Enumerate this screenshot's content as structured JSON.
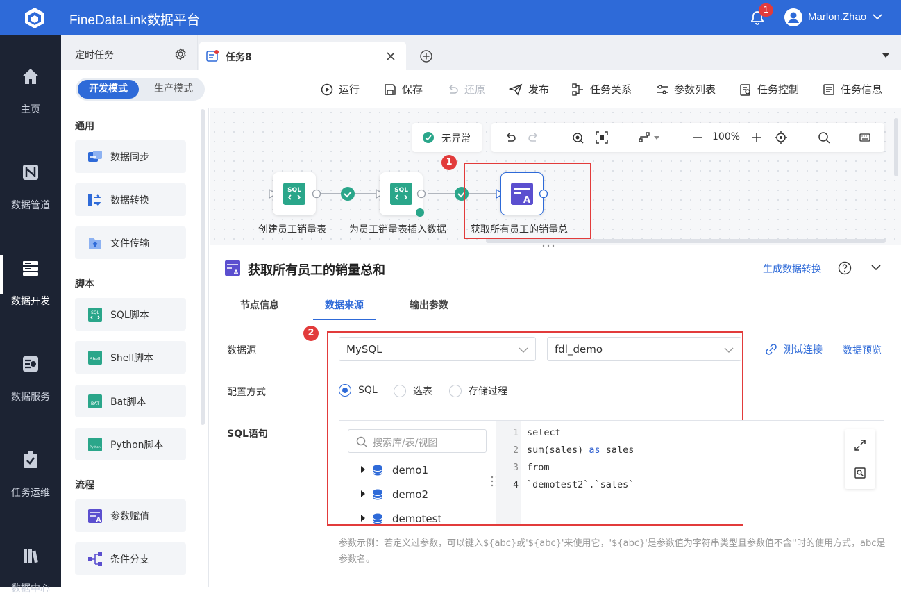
{
  "app": {
    "title": "FineDataLink数据平台",
    "notifications": "1",
    "user": "Marlon.Zhao"
  },
  "leftnav": [
    {
      "label": "主页",
      "icon": "home-icon"
    },
    {
      "label": "数据管道",
      "icon": "pipeline-icon"
    },
    {
      "label": "数据开发",
      "icon": "data-dev-icon",
      "active": true
    },
    {
      "label": "数据服务",
      "icon": "data-service-icon"
    },
    {
      "label": "任务运维",
      "icon": "task-ops-icon"
    },
    {
      "label": "数据中心",
      "icon": "data-center-icon"
    }
  ],
  "tabs": {
    "fixed": "定时任务",
    "active": "任务8"
  },
  "toolbar": {
    "mode_dev": "开发模式",
    "mode_prod": "生产模式",
    "run": "运行",
    "save": "保存",
    "restore": "还原",
    "publish": "发布",
    "relations": "任务关系",
    "params": "参数列表",
    "control": "任务控制",
    "info": "任务信息"
  },
  "palette": {
    "groups": [
      {
        "title": "通用",
        "items": [
          "数据同步",
          "数据转换",
          "文件传输"
        ]
      },
      {
        "title": "脚本",
        "items": [
          "SQL脚本",
          "Shell脚本",
          "Bat脚本",
          "Python脚本"
        ]
      },
      {
        "title": "流程",
        "items": [
          "参数赋值",
          "条件分支"
        ]
      }
    ]
  },
  "canvas": {
    "status": "无异常",
    "zoom": "100%",
    "nodes": [
      "创建员工销量表",
      "为员工销量表插入数据",
      "获取所有员工的销量总"
    ],
    "markers": [
      "1",
      "2"
    ]
  },
  "panel": {
    "title": "获取所有员工的销量总和",
    "gen_link": "生成数据转换",
    "tabs": [
      "节点信息",
      "数据来源",
      "输出参数"
    ],
    "active_tab": "数据来源",
    "datasource_label": "数据源",
    "datasource_type": "MySQL",
    "datasource_name": "fdl_demo",
    "test_conn": "测试连接",
    "preview": "数据预览",
    "config_label": "配置方式",
    "config_options": [
      "SQL",
      "选表",
      "存储过程"
    ],
    "config_selected": "SQL",
    "sql_label": "SQL语句",
    "search_placeholder": "搜索库/表/视图",
    "tree": [
      "demo1",
      "demo2",
      "demotest"
    ],
    "code_lines": [
      {
        "n": "1",
        "text": "select"
      },
      {
        "n": "2",
        "text": "sum(sales) as sales"
      },
      {
        "n": "3",
        "text": "from"
      },
      {
        "n": "4",
        "text": "`demotest2`.`sales`"
      }
    ],
    "hint": "参数示例：若定义过参数，可以键入${abc}或'${abc}'来使用它，'${abc}'是参数值为字符串类型且参数值不含''时的使用方式，abc是参数名。"
  },
  "colors": {
    "brand": "#2e6ad8",
    "nav_bg": "#1c2333",
    "marker": "#e23b3b",
    "success": "#2aa68a"
  }
}
